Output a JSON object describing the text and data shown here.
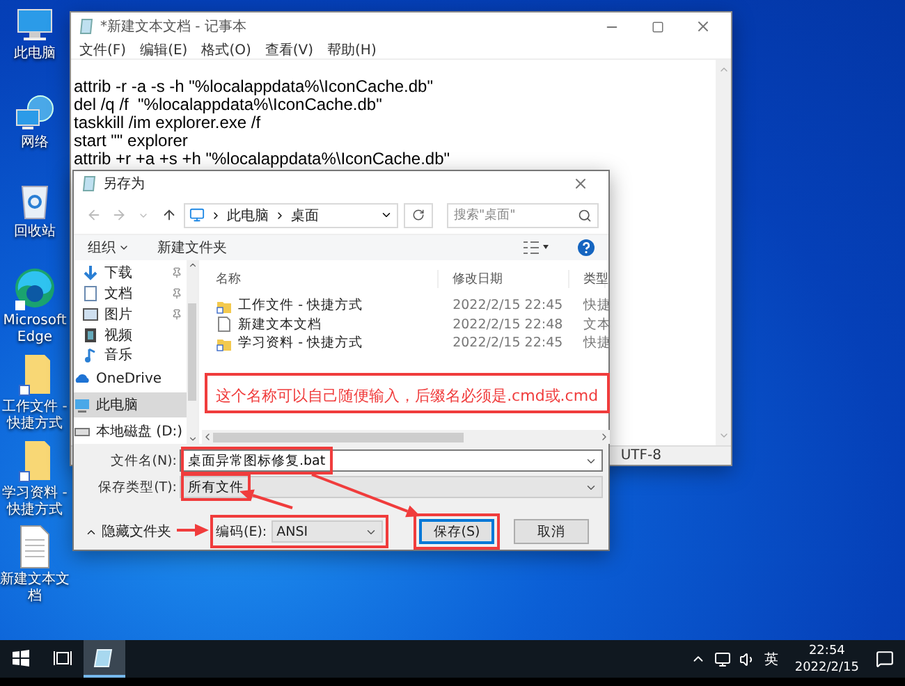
{
  "desktop_icons": [
    {
      "label": "此电脑",
      "kind": "pc"
    },
    {
      "label": "网络",
      "kind": "network"
    },
    {
      "label": "回收站",
      "kind": "recycle_bin"
    },
    {
      "label": "Microsoft Edge",
      "kind": "edge"
    },
    {
      "label": "工作文件 - 快捷方式",
      "kind": "folder_shortcut"
    },
    {
      "label": "学习资料 - 快捷方式",
      "kind": "folder_shortcut"
    },
    {
      "label": "新建文本文档",
      "kind": "text_file"
    }
  ],
  "notepad": {
    "title": "*新建文本文档 - 记事本",
    "menu": [
      "文件(F)",
      "编辑(E)",
      "格式(O)",
      "查看(V)",
      "帮助(H)"
    ],
    "lines": [
      "attrib -r -a -s -h \"%localappdata%\\IconCache.db\"",
      "del /q /f  \"%localappdata%\\IconCache.db\"",
      "taskkill /im explorer.exe /f",
      "start \"\" explorer",
      "attrib +r +a +s +h \"%localappdata%\\IconCache.db\""
    ],
    "status_encoding": "UTF-8"
  },
  "save_dialog": {
    "title": "另存为",
    "breadcrumb": [
      "此电脑",
      "桌面"
    ],
    "search_placeholder": "搜索\"桌面\"",
    "toolbar": [
      "组织",
      "新建文件夹"
    ],
    "nav_items": [
      {
        "label": "下载",
        "kind": "download",
        "pinned": true,
        "selected": false
      },
      {
        "label": "文档",
        "kind": "documents",
        "pinned": true,
        "selected": false
      },
      {
        "label": "图片",
        "kind": "pictures",
        "pinned": true,
        "selected": false
      },
      {
        "label": "视频",
        "kind": "videos",
        "pinned": false,
        "selected": false
      },
      {
        "label": "音乐",
        "kind": "music",
        "pinned": false,
        "selected": false
      },
      {
        "label": "OneDrive",
        "kind": "onedrive",
        "pinned": false,
        "selected": false
      },
      {
        "label": "此电脑",
        "kind": "pc",
        "pinned": false,
        "selected": true
      },
      {
        "label": "本地磁盘 (D:)",
        "kind": "drive",
        "pinned": false,
        "selected": false
      }
    ],
    "columns": [
      "名称",
      "修改日期",
      "类型"
    ],
    "files": [
      {
        "name": "工作文件 - 快捷方式",
        "kind": "folder_shortcut",
        "date": "2022/2/15 22:45",
        "type": "快捷"
      },
      {
        "name": "新建文本文档",
        "kind": "text_file",
        "date": "2022/2/15 22:48",
        "type": "文本"
      },
      {
        "name": "学习资料 - 快捷方式",
        "kind": "folder_shortcut",
        "date": "2022/2/15 22:45",
        "type": "快捷"
      }
    ],
    "annotation": "这个名称可以自己随便输入，后缀名必须是.cmd或.cmd",
    "filename": {
      "label": "文件名(N):",
      "value": "桌面异常图标修复.bat",
      "highlighted": true
    },
    "save_type": {
      "label": "保存类型(T):",
      "value": "所有文件",
      "highlighted": true
    },
    "hide_folders": "隐藏文件夹",
    "encoding": {
      "label": "编码(E):",
      "value": "ANSI",
      "highlighted": true
    },
    "buttons": [
      {
        "label": "保存(S)",
        "primary": true,
        "highlighted": true
      },
      {
        "label": "取消",
        "primary": false,
        "highlighted": false
      }
    ]
  },
  "taskbar": {
    "apps": [
      {
        "kind": "notepad",
        "active": true
      }
    ],
    "ime": "英",
    "time": "22:54",
    "date": "2022/2/15"
  }
}
